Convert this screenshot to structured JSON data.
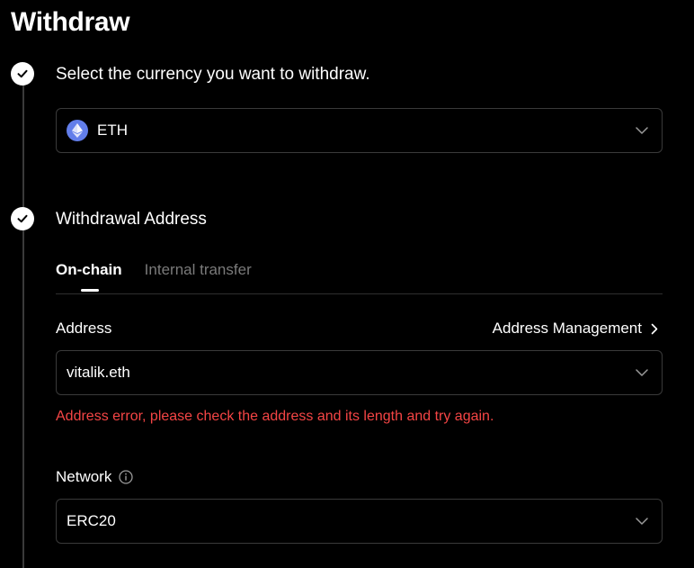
{
  "page": {
    "title": "Withdraw"
  },
  "steps": {
    "currency": {
      "title": "Select the currency you want to withdraw.",
      "selected": "ETH",
      "coin_color": "#627eea"
    },
    "address": {
      "title": "Withdrawal Address",
      "tabs": [
        {
          "label": "On-chain",
          "active": true
        },
        {
          "label": "Internal transfer",
          "active": false
        }
      ],
      "address_label": "Address",
      "address_management_label": "Address Management",
      "address_value": "vitalik.eth",
      "error_message": "Address error, please check the address and its length and try again.",
      "error_color": "#f54545",
      "network_label": "Network",
      "network_value": "ERC20"
    }
  }
}
